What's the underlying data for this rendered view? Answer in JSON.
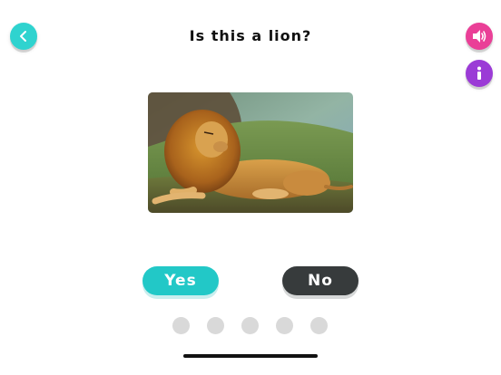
{
  "header": {
    "question": "Is this a lion?",
    "back_icon": "chevron-left-icon",
    "sound_icon": "speaker-icon",
    "info_icon": "info-icon"
  },
  "colors": {
    "back": "#2fd3cf",
    "sound": "#ea3f97",
    "info": "#9b3bd6",
    "yes": "#22c8c7",
    "no": "#373b3c",
    "dot_inactive": "#d9d9d9"
  },
  "image": {
    "subject": "lion"
  },
  "answers": {
    "yes_label": "Yes",
    "no_label": "No"
  },
  "progress": {
    "total": 5,
    "current": 0
  }
}
